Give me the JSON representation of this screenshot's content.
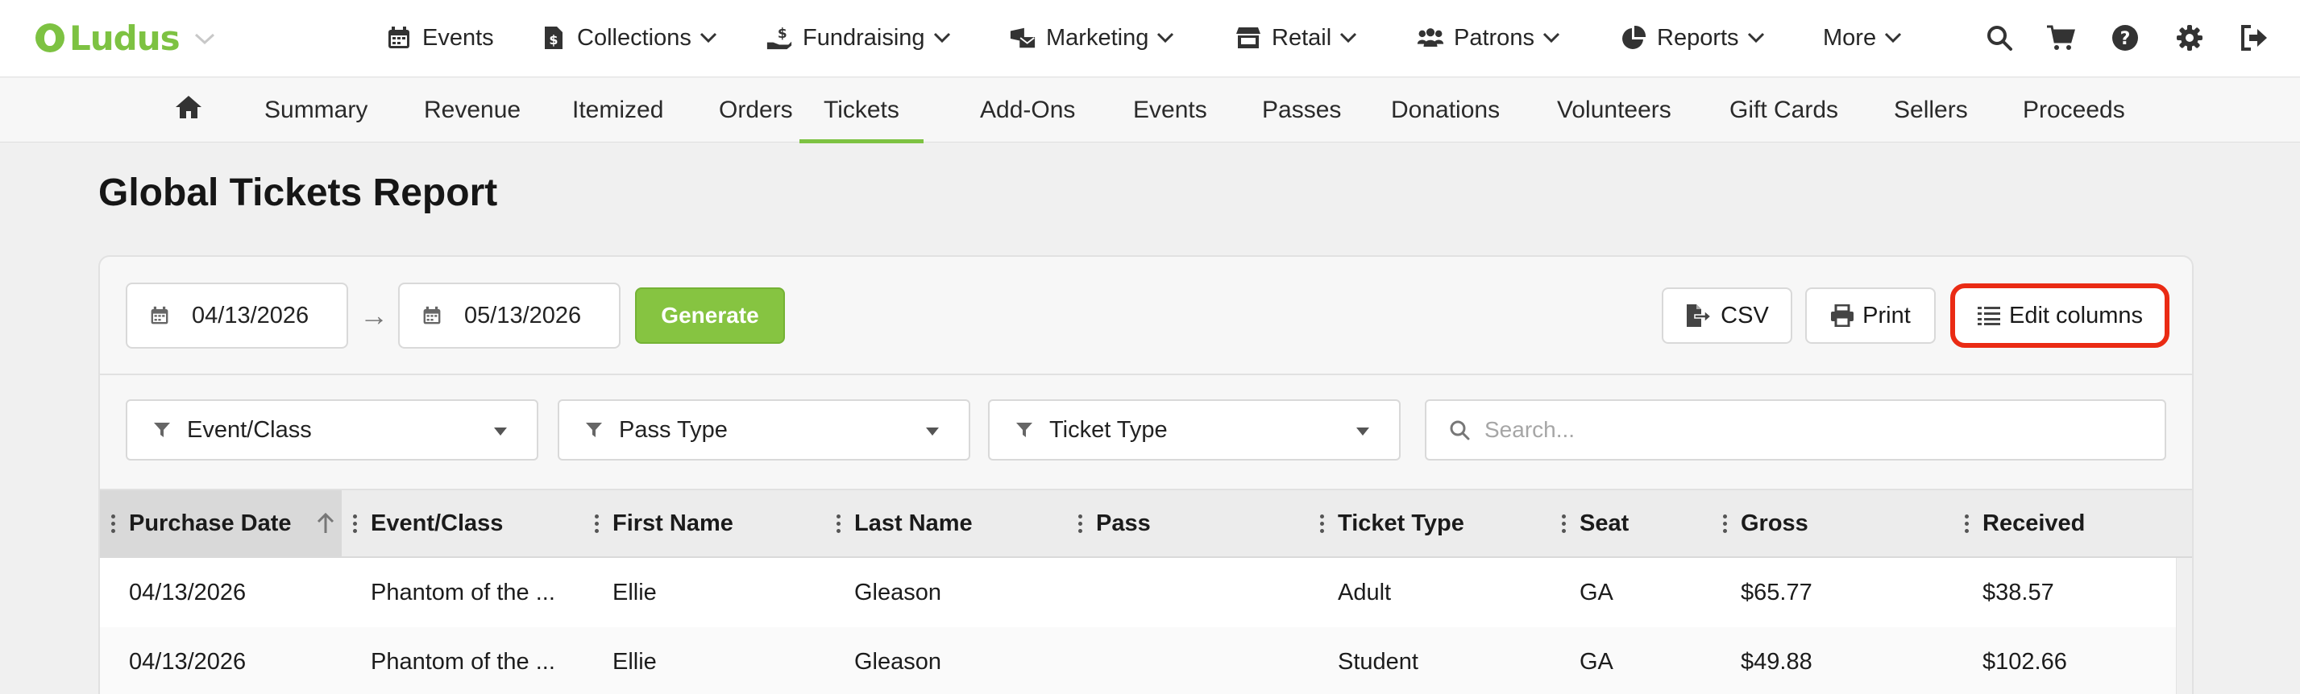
{
  "brand": {
    "name": "Ludus",
    "color": "#7dc242",
    "highlight_color": "#ea2b14"
  },
  "topnav": {
    "items": [
      {
        "label": "Events",
        "icon": "calendar-icon",
        "has_dropdown": false
      },
      {
        "label": "Collections",
        "icon": "dollar-file-icon",
        "has_dropdown": true
      },
      {
        "label": "Fundraising",
        "icon": "hand-dollar-icon",
        "has_dropdown": true
      },
      {
        "label": "Marketing",
        "icon": "mail-bullhorn-icon",
        "has_dropdown": true
      },
      {
        "label": "Retail",
        "icon": "store-icon",
        "has_dropdown": true
      },
      {
        "label": "Patrons",
        "icon": "users-icon",
        "has_dropdown": true
      },
      {
        "label": "Reports",
        "icon": "pie-chart-icon",
        "has_dropdown": true
      },
      {
        "label": "More",
        "icon": "",
        "has_dropdown": true
      }
    ],
    "right_icons": [
      "search-icon",
      "cart-icon",
      "help-icon",
      "gear-icon",
      "sign-out-icon"
    ]
  },
  "subnav": {
    "items": [
      "Summary",
      "Revenue",
      "Itemized",
      "Orders",
      "Tickets",
      "Add-Ons",
      "Events",
      "Passes",
      "Donations",
      "Volunteers",
      "Gift Cards",
      "Sellers",
      "Proceeds"
    ],
    "active": "Tickets"
  },
  "page": {
    "title": "Global Tickets Report"
  },
  "toolbar": {
    "start_date": "04/13/2026",
    "arrow": "→",
    "end_date": "05/13/2026",
    "generate_label": "Generate",
    "csv_label": "CSV",
    "print_label": "Print",
    "edit_columns_label": "Edit columns"
  },
  "filters": {
    "event_class": "Event/Class",
    "pass_type": "Pass Type",
    "ticket_type": "Ticket Type",
    "search_placeholder": "Search..."
  },
  "table": {
    "sorted_column": "Purchase Date",
    "sort_direction": "ascending",
    "columns": [
      "Purchase Date",
      "Event/Class",
      "First Name",
      "Last Name",
      "Pass",
      "Ticket Type",
      "Seat",
      "Gross",
      "Received"
    ],
    "rows": [
      [
        "04/13/2026",
        "Phantom of the ...",
        "Ellie",
        "Gleason",
        "",
        "Adult",
        "GA",
        "$65.77",
        "$38.57"
      ],
      [
        "04/13/2026",
        "Phantom of the ...",
        "Ellie",
        "Gleason",
        "",
        "Student",
        "GA",
        "$49.88",
        "$102.66"
      ]
    ]
  }
}
